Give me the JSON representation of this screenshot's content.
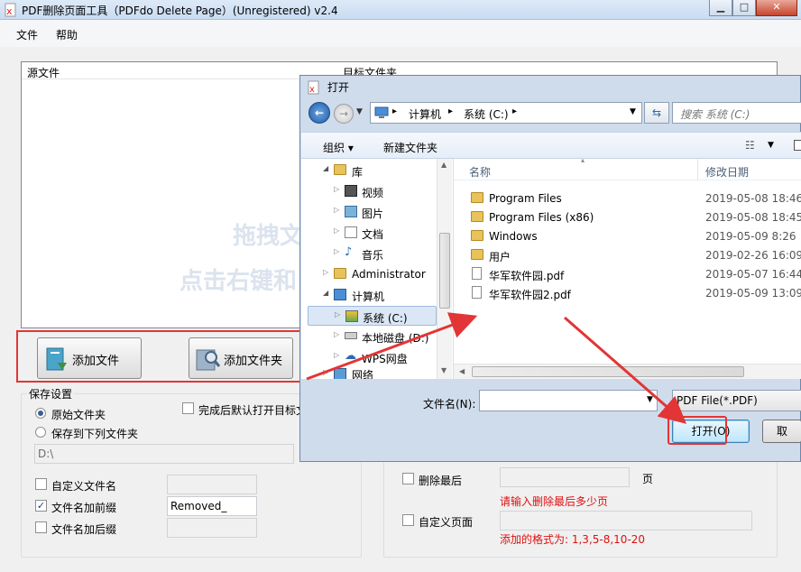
{
  "app": {
    "title": "PDF删除页面工具（PDFdo Delete Page）(Unregistered) v2.4",
    "min_glyph": "▁",
    "max_glyph": "□",
    "close_glyph": "✕"
  },
  "menu": {
    "file": "文件",
    "help": "帮助"
  },
  "list": {
    "col_source": "源文件",
    "col_target": "目标文件夹",
    "hint_line1": "拖拽文",
    "hint_line2": "点击右键和"
  },
  "buttons": {
    "add_file": "添加文件",
    "add_folder": "添加文件夹"
  },
  "save": {
    "title": "保存设置",
    "original_folder": "原始文件夹",
    "save_to_folder": "保存到下列文件夹",
    "open_after": "完成后默认打开目标文",
    "folder_value": "D:\\",
    "custom_name": "自定义文件名",
    "add_prefix": "文件名加前缀",
    "add_suffix": "文件名加后缀",
    "prefix_value": "Removed_",
    "prefix_checked": true,
    "original_selected": true
  },
  "delete": {
    "delete_last": "删除最后",
    "page_unit": "页",
    "hint_last": "请输入删除最后多少页",
    "custom_pages": "自定义页面",
    "format_hint": "添加的格式为: 1,3,5-8,10-20"
  },
  "dialog": {
    "title": "打开",
    "breadcrumb": [
      "计算机",
      "系统 (C:)"
    ],
    "search_placeholder": "搜索 系统 (C:)",
    "organize": "组织 ▾",
    "new_folder": "新建文件夹",
    "nav": [
      {
        "label": "库",
        "icon": "library-icon",
        "level": 1,
        "expanded": true
      },
      {
        "label": "视频",
        "icon": "video-icon",
        "level": 2
      },
      {
        "label": "图片",
        "icon": "picture-icon",
        "level": 2
      },
      {
        "label": "文档",
        "icon": "document-icon",
        "level": 2
      },
      {
        "label": "音乐",
        "icon": "music-icon",
        "level": 2
      },
      {
        "label": "Administrator",
        "icon": "user-folder-icon",
        "level": 1
      },
      {
        "label": "计算机",
        "icon": "computer-icon",
        "level": 1,
        "expanded": true
      },
      {
        "label": "系统 (C:)",
        "icon": "system-drive-icon",
        "level": 2,
        "selected": true
      },
      {
        "label": "本地磁盘 (D:)",
        "icon": "drive-icon",
        "level": 2
      },
      {
        "label": "WPS网盘",
        "icon": "cloud-icon",
        "level": 2
      },
      {
        "label": "网络",
        "icon": "network-icon",
        "level": 1
      }
    ],
    "columns": {
      "name": "名称",
      "modified": "修改日期"
    },
    "files": [
      {
        "name": "Program Files",
        "date": "2019-05-08 18:46",
        "icon": "folder-icon"
      },
      {
        "name": "Program Files (x86)",
        "date": "2019-05-08 18:45",
        "icon": "folder-icon"
      },
      {
        "name": "Windows",
        "date": "2019-05-09 8:26",
        "icon": "folder-icon"
      },
      {
        "name": "用户",
        "date": "2019-02-26 16:09",
        "icon": "folder-icon"
      },
      {
        "name": "华军软件园.pdf",
        "date": "2019-05-07 16:44",
        "icon": "pdf-file-icon"
      },
      {
        "name": "华军软件园2.pdf",
        "date": "2019-05-09 13:09",
        "icon": "pdf-file-icon"
      }
    ],
    "filename_label": "文件名(N):",
    "filename_value": "",
    "filter": "PDF File(*.PDF)",
    "open_button": "打开(O)",
    "cancel_button": "取"
  },
  "colors": {
    "highlight": "#e33535",
    "accent": "#3a6ea5",
    "hint_red": "#dd1111"
  }
}
